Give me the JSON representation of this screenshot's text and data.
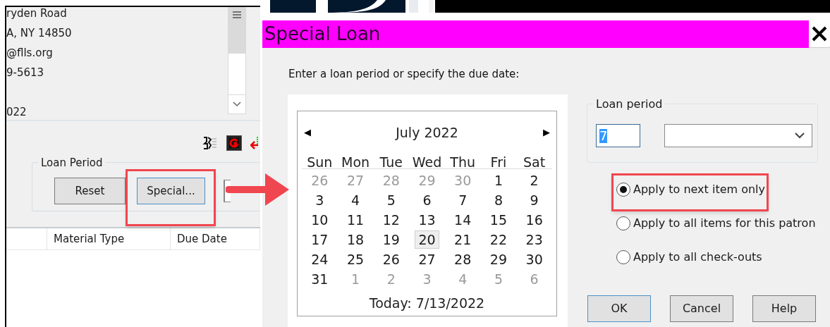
{
  "patron_info": {
    "lines": [
      {
        "text": "ryden Road",
        "gap_before": false
      },
      {
        "text": "A, NY 14850",
        "gap_before": false
      },
      {
        "text": "@flls.org",
        "gap_before": false
      },
      {
        "text": "9-5613",
        "gap_before": false
      },
      {
        "text": "022",
        "gap_before": true
      }
    ]
  },
  "loan_period_group": {
    "title": "Loan Period",
    "buttons": [
      {
        "label": "Reset",
        "focused": false
      },
      {
        "label": "Special...",
        "focused": true
      }
    ]
  },
  "table": {
    "columns": [
      "Material Type",
      "Due Date"
    ]
  },
  "dialog": {
    "title": "Special Loan",
    "instruction": "Enter a loan period or specify the due date:",
    "calendar": {
      "prev": "◀",
      "month": "July 2022",
      "next": "▶",
      "weekdays": [
        "Sun",
        "Mon",
        "Tue",
        "Wed",
        "Thu",
        "Fri",
        "Sat"
      ],
      "weeks": [
        [
          {
            "day": "26",
            "outside": true,
            "selected": false
          },
          {
            "day": "27",
            "outside": true,
            "selected": false
          },
          {
            "day": "28",
            "outside": true,
            "selected": false
          },
          {
            "day": "29",
            "outside": true,
            "selected": false
          },
          {
            "day": "30",
            "outside": true,
            "selected": false
          },
          {
            "day": "1",
            "outside": false,
            "selected": false
          },
          {
            "day": "2",
            "outside": false,
            "selected": false
          }
        ],
        [
          {
            "day": "3",
            "outside": false,
            "selected": false
          },
          {
            "day": "4",
            "outside": false,
            "selected": false
          },
          {
            "day": "5",
            "outside": false,
            "selected": false
          },
          {
            "day": "6",
            "outside": false,
            "selected": false
          },
          {
            "day": "7",
            "outside": false,
            "selected": false
          },
          {
            "day": "8",
            "outside": false,
            "selected": false
          },
          {
            "day": "9",
            "outside": false,
            "selected": false
          }
        ],
        [
          {
            "day": "10",
            "outside": false,
            "selected": false
          },
          {
            "day": "11",
            "outside": false,
            "selected": false
          },
          {
            "day": "12",
            "outside": false,
            "selected": false
          },
          {
            "day": "13",
            "outside": false,
            "selected": false
          },
          {
            "day": "14",
            "outside": false,
            "selected": false
          },
          {
            "day": "15",
            "outside": false,
            "selected": false
          },
          {
            "day": "16",
            "outside": false,
            "selected": false
          }
        ],
        [
          {
            "day": "17",
            "outside": false,
            "selected": false
          },
          {
            "day": "18",
            "outside": false,
            "selected": false
          },
          {
            "day": "19",
            "outside": false,
            "selected": false
          },
          {
            "day": "20",
            "outside": false,
            "selected": true
          },
          {
            "day": "21",
            "outside": false,
            "selected": false
          },
          {
            "day": "22",
            "outside": false,
            "selected": false
          },
          {
            "day": "23",
            "outside": false,
            "selected": false
          }
        ],
        [
          {
            "day": "24",
            "outside": false,
            "selected": false
          },
          {
            "day": "25",
            "outside": false,
            "selected": false
          },
          {
            "day": "26",
            "outside": false,
            "selected": false
          },
          {
            "day": "27",
            "outside": false,
            "selected": false
          },
          {
            "day": "28",
            "outside": false,
            "selected": false
          },
          {
            "day": "29",
            "outside": false,
            "selected": false
          },
          {
            "day": "30",
            "outside": false,
            "selected": false
          }
        ],
        [
          {
            "day": "31",
            "outside": false,
            "selected": false
          },
          {
            "day": "1",
            "outside": true,
            "selected": false
          },
          {
            "day": "2",
            "outside": true,
            "selected": false
          },
          {
            "day": "3",
            "outside": true,
            "selected": false
          },
          {
            "day": "4",
            "outside": true,
            "selected": false
          },
          {
            "day": "5",
            "outside": true,
            "selected": false
          },
          {
            "day": "6",
            "outside": true,
            "selected": false
          }
        ]
      ],
      "today": "Today: 7/13/2022"
    },
    "loan_period": {
      "title": "Loan period",
      "value": "7"
    },
    "apply_options": [
      {
        "label": "Apply to next item only",
        "selected": true
      },
      {
        "label": "Apply to all items for this patron",
        "selected": false
      },
      {
        "label": "Apply to all check-outs",
        "selected": false
      }
    ],
    "buttons": [
      {
        "label": "OK",
        "default": true
      },
      {
        "label": "Cancel",
        "default": false
      },
      {
        "label": "Help",
        "default": false
      }
    ]
  }
}
